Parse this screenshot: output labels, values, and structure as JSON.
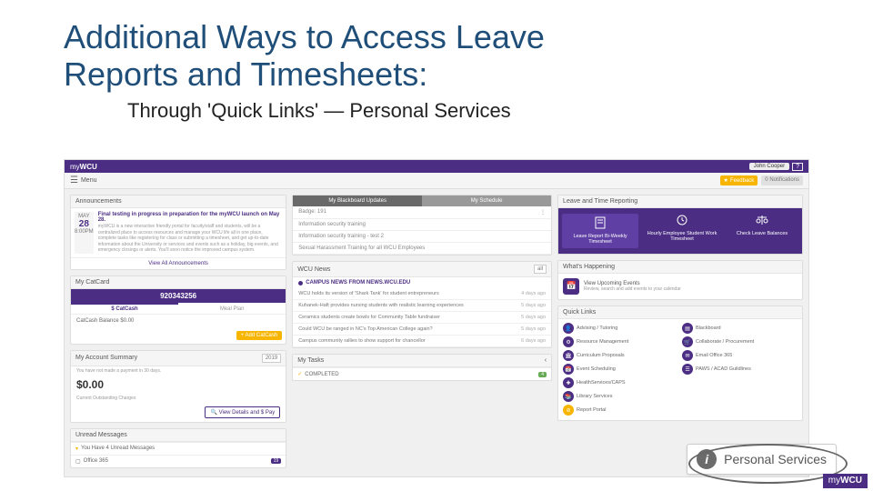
{
  "slide": {
    "title_l1": "Additional Ways to Access Leave",
    "title_l2": "Reports and Timesheets:",
    "subtitle": "Through   'Quick Links'  —   Personal Services"
  },
  "topbar": {
    "brand_pre": "my",
    "brand_bold": "WCU",
    "user": "John Cooper",
    "help": "?"
  },
  "subbar": {
    "menu": "Menu",
    "feedback": "Feedback",
    "notifications": "Notifications",
    "notif_count": "0"
  },
  "announcements": {
    "header": "Announcements",
    "day": "MAY",
    "daynum": "28",
    "time": "8:00PM",
    "title": "Final testing in progress in preparation for the myWCU launch on May 28.",
    "body": "myWCU is a new interactive friendly portal for faculty/staff and students, will be a centralized place to access resources and manage your WCU life all in one place, complete tasks like registering for class or submitting a timesheet, and get up-to-date information about the University or services and events such as a holiday, big events, and emergency closings or alerts. You'll soon notice the improved campus system.",
    "viewall": "View All Announcements"
  },
  "catcard": {
    "header": "My CatCard",
    "id": "920343256",
    "tab1": "$ CatCash",
    "tab2": "Meal Plan",
    "balance_lbl": "CatCash Balance $0.00",
    "add": "+ Add CatCash"
  },
  "account": {
    "header": "My Account Summary",
    "select": "2019",
    "note": "You have not made a payment in 30 days.",
    "big": "$0.00",
    "charges": "Current Outstanding Charges",
    "view": "🔍 View Details and $ Pay"
  },
  "messages": {
    "header": "Unread Messages",
    "row": "You Have 4 Unread Messages",
    "office": "Office 365",
    "count": "19"
  },
  "bbtabs": {
    "tab1": "My Blackboard Updates",
    "tab2": "My Schedule",
    "badge": "Badge: 191",
    "r1": "Information security training",
    "r2": "Information security training - test 2",
    "r3": "Sexual Harassment Training for all WCU Employees"
  },
  "news": {
    "header": "WCU News",
    "select": "all",
    "top": "CAMPUS NEWS FROM NEWS.WCU.EDU",
    "items": [
      {
        "t": "WCU holds its version of 'Shark Tank' for student entrepreneurs",
        "d": "4 days ago"
      },
      {
        "t": "Kuhanek-Haft provides nursing students with realistic learning experiences",
        "d": "5 days ago"
      },
      {
        "t": "Ceramics students create bowls for Community Table fundraiser",
        "d": "5 days ago"
      },
      {
        "t": "Could WCU be ranged in NC's Top American College again?",
        "d": "5 days ago"
      },
      {
        "t": "Campus community rallies to show support for chancellor",
        "d": "6 days ago"
      }
    ]
  },
  "tasks": {
    "header": "My Tasks",
    "row": "COMPLETED",
    "pager": "‹"
  },
  "ltr": {
    "header": "Leave and Time Reporting",
    "t1": "Leave Report Bi-Weekly Timesheet",
    "t2": "Hourly Employee Student Work Timesheet",
    "t3": "Check Leave Balances"
  },
  "wh": {
    "header": "What's Happening",
    "title": "View Upcoming Events",
    "sub": "Review, search and add events to your calendar"
  },
  "ql": {
    "header": "Quick Links",
    "items_l": [
      "Advising / Tutoring",
      "Resource Management",
      "Curriculum Proposals",
      "Event Scheduling",
      "HealthServices/CAPS",
      "Library Services",
      "Report Portal"
    ],
    "items_r": [
      "Blackboard",
      "Collaborate / Procurement",
      "Email Office 365",
      "PAWS / ACAD Guildlines"
    ]
  },
  "callout": {
    "label": "Personal Services"
  },
  "footbrand": {
    "pre": "my",
    "bold": "WCU"
  }
}
